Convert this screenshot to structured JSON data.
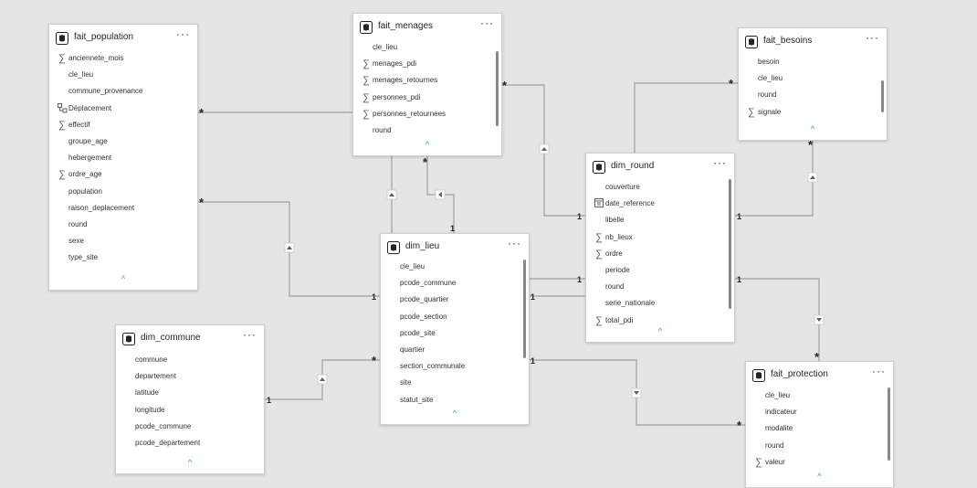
{
  "tables": [
    {
      "id": "fait_population",
      "title": "fait_population",
      "more": "···",
      "fields": [
        {
          "name": "anciennete_mois",
          "icon": "sigma"
        },
        {
          "name": "cle_lieu",
          "icon": ""
        },
        {
          "name": "commune_provenance",
          "icon": ""
        },
        {
          "name": "Déplacement",
          "icon": "hierarchy"
        },
        {
          "name": "effectif",
          "icon": "sigma"
        },
        {
          "name": "groupe_age",
          "icon": ""
        },
        {
          "name": "hebergement",
          "icon": ""
        },
        {
          "name": "ordre_age",
          "icon": "sigma"
        },
        {
          "name": "population",
          "icon": ""
        },
        {
          "name": "raison_deplacement",
          "icon": ""
        },
        {
          "name": "round",
          "icon": ""
        },
        {
          "name": "sexe",
          "icon": ""
        },
        {
          "name": "type_site",
          "icon": ""
        }
      ],
      "collapse": "^"
    },
    {
      "id": "fait_menages",
      "title": "fait_menages",
      "more": "···",
      "fields": [
        {
          "name": "cle_lieu",
          "icon": ""
        },
        {
          "name": "menages_pdi",
          "icon": "sigma"
        },
        {
          "name": "menages_retournes",
          "icon": "sigma"
        },
        {
          "name": "personnes_pdi",
          "icon": "sigma"
        },
        {
          "name": "personnes_retournees",
          "icon": "sigma"
        },
        {
          "name": "round",
          "icon": ""
        }
      ],
      "collapse": "^"
    },
    {
      "id": "fait_besoins",
      "title": "fait_besoins",
      "more": "···",
      "fields": [
        {
          "name": "besoin",
          "icon": ""
        },
        {
          "name": "cle_lieu",
          "icon": ""
        },
        {
          "name": "round",
          "icon": ""
        },
        {
          "name": "signale",
          "icon": "sigma"
        }
      ],
      "collapse": "^"
    },
    {
      "id": "dim_round",
      "title": "dim_round",
      "more": "···",
      "fields": [
        {
          "name": "couverture",
          "icon": ""
        },
        {
          "name": "date_reference",
          "icon": "calendar"
        },
        {
          "name": "libelle",
          "icon": ""
        },
        {
          "name": "nb_lieux",
          "icon": "sigma"
        },
        {
          "name": "ordre",
          "icon": "sigma"
        },
        {
          "name": "periode",
          "icon": ""
        },
        {
          "name": "round",
          "icon": ""
        },
        {
          "name": "serie_nationale",
          "icon": ""
        },
        {
          "name": "total_pdi",
          "icon": "sigma"
        }
      ],
      "collapse": "^"
    },
    {
      "id": "dim_lieu",
      "title": "dim_lieu",
      "more": "···",
      "fields": [
        {
          "name": "cle_lieu",
          "icon": ""
        },
        {
          "name": "pcode_commune",
          "icon": ""
        },
        {
          "name": "pcode_quartier",
          "icon": ""
        },
        {
          "name": "pcode_section",
          "icon": ""
        },
        {
          "name": "pcode_site",
          "icon": ""
        },
        {
          "name": "quartier",
          "icon": ""
        },
        {
          "name": "section_communale",
          "icon": ""
        },
        {
          "name": "site",
          "icon": ""
        },
        {
          "name": "statut_site",
          "icon": ""
        }
      ],
      "collapse": "^"
    },
    {
      "id": "dim_commune",
      "title": "dim_commune",
      "more": "···",
      "fields": [
        {
          "name": "commune",
          "icon": ""
        },
        {
          "name": "departement",
          "icon": ""
        },
        {
          "name": "latitude",
          "icon": ""
        },
        {
          "name": "longitude",
          "icon": ""
        },
        {
          "name": "pcode_commune",
          "icon": ""
        },
        {
          "name": "pcode_departement",
          "icon": ""
        }
      ],
      "collapse": "^"
    },
    {
      "id": "fait_protection",
      "title": "fait_protection",
      "more": "···",
      "fields": [
        {
          "name": "cle_lieu",
          "icon": ""
        },
        {
          "name": "indicateur",
          "icon": ""
        },
        {
          "name": "modalite",
          "icon": ""
        },
        {
          "name": "round",
          "icon": ""
        },
        {
          "name": "valeur",
          "icon": "sigma"
        }
      ],
      "collapse": "^"
    }
  ],
  "relationships": [
    {
      "from": "fait_population",
      "to": "fait_menages",
      "from_card": "*",
      "to_card": ""
    },
    {
      "from": "fait_population",
      "to": "dim_lieu",
      "from_card": "*",
      "to_card": "1"
    },
    {
      "from": "fait_menages",
      "to": "dim_lieu",
      "from_card": "*",
      "to_card": "1"
    },
    {
      "from": "fait_menages",
      "to": "dim_round",
      "from_card": "*",
      "to_card": "1"
    },
    {
      "from": "fait_besoins",
      "to": "dim_round",
      "from_card": "*",
      "to_card": ""
    },
    {
      "from": "fait_besoins",
      "to": "dim_round",
      "from_card": "*",
      "to_card": "1"
    },
    {
      "from": "dim_lieu",
      "to": "dim_round",
      "from_card": "1",
      "to_card": "1"
    },
    {
      "from": "dim_commune",
      "to": "dim_lieu",
      "from_card": "1",
      "to_card": "*"
    },
    {
      "from": "dim_lieu",
      "to": "fait_protection",
      "from_card": "1",
      "to_card": "*"
    },
    {
      "from": "dim_round",
      "to": "fait_protection",
      "from_card": "1",
      "to_card": "*"
    }
  ],
  "colors": {
    "background": "#e6e5e4",
    "card": "#ffffff",
    "line": "#a19f9d",
    "accent": "#3a9e8f"
  }
}
